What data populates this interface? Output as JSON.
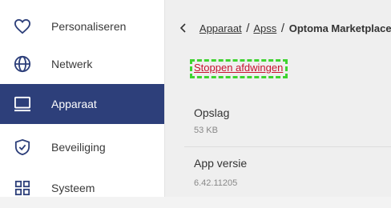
{
  "sidebar": {
    "items": [
      {
        "label": "Personaliseren",
        "icon": "heart-icon"
      },
      {
        "label": "Netwerk",
        "icon": "globe-icon"
      },
      {
        "label": "Apparaat",
        "icon": "monitor-icon",
        "active": true
      },
      {
        "label": "Beveiliging",
        "icon": "shield-check-icon"
      },
      {
        "label": "Systeem",
        "icon": "grid-icon"
      }
    ]
  },
  "breadcrumb": {
    "back_icon": "chevron-left-icon",
    "parts": [
      "Apparaat",
      "Apss"
    ],
    "current": "Optoma Marketplace"
  },
  "actions": {
    "force_stop": "Stoppen afdwingen"
  },
  "details": {
    "storage": {
      "label": "Opslag",
      "value": "53 KB"
    },
    "version": {
      "label": "App versie",
      "value": "6.42.11205"
    }
  },
  "colors": {
    "sidebar_active": "#2d3f7a",
    "force_stop_text": "#c8102e",
    "highlight_box": "#3fd430"
  }
}
